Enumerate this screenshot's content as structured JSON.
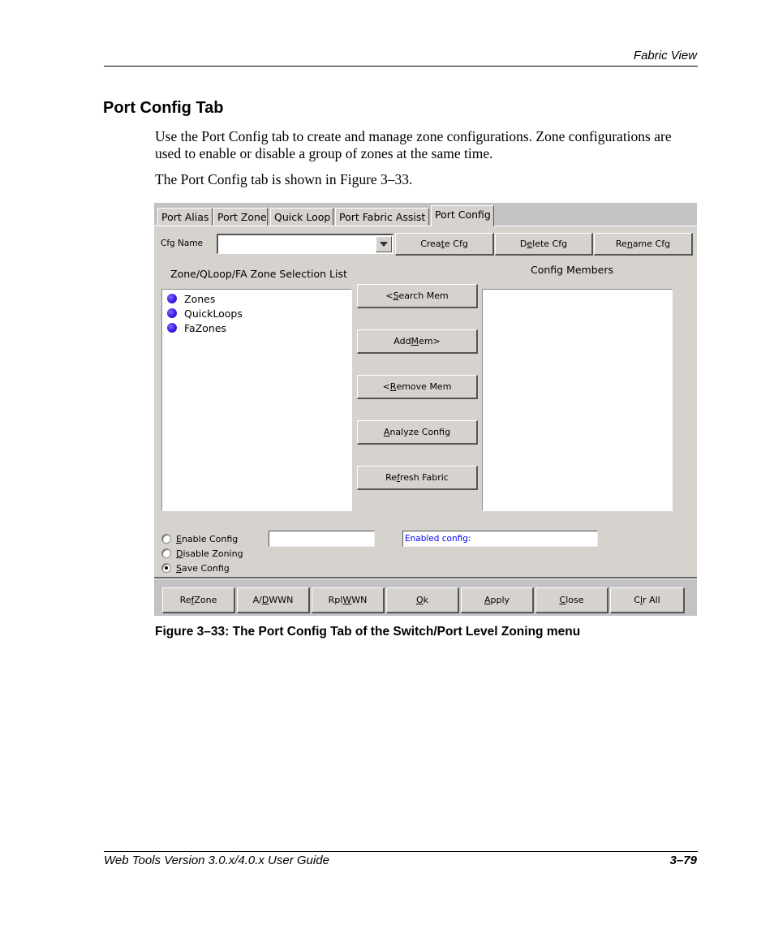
{
  "page_header": {
    "section": "Fabric View"
  },
  "section_title": "Port Config Tab",
  "paragraphs": [
    "Use the Port Config tab to create and manage zone configurations. Zone configurations are used to enable or disable a group of zones at the same time.",
    "The Port Config tab is shown in Figure 3–33."
  ],
  "ui": {
    "tabs": [
      {
        "label": "Port Alias",
        "active": false
      },
      {
        "label": "Port Zone",
        "active": false
      },
      {
        "label": "Quick Loop",
        "active": false
      },
      {
        "label": "Port Fabric Assist",
        "active": false
      },
      {
        "label": "Port Config",
        "active": true
      }
    ],
    "cfg_name": {
      "label": "Cfg Name",
      "value": ""
    },
    "top_buttons": {
      "create": {
        "pre": "Crea",
        "mn": "t",
        "post": "e Cfg"
      },
      "delete": {
        "pre": "D",
        "mn": "e",
        "post": "lete Cfg"
      },
      "rename": {
        "pre": "Re",
        "mn": "n",
        "post": "ame Cfg"
      }
    },
    "selection_list": {
      "title": "Zone/QLoop/FA Zone Selection List",
      "items": [
        "Zones",
        "QuickLoops",
        "FaZones"
      ],
      "icon": "blue-dot-icon",
      "icon_color": "#3a1de0"
    },
    "config_members": {
      "title": "Config Members",
      "items": []
    },
    "middle_buttons": {
      "search": {
        "pre": "<",
        "mn": "S",
        "post": "earch Mem"
      },
      "add": {
        "pre": "Add ",
        "mn": "M",
        "post": "em>"
      },
      "remove": {
        "pre": "<",
        "mn": "R",
        "post": "emove Mem"
      },
      "analyze": {
        "pre": "",
        "mn": "A",
        "post": "nalyze Config"
      },
      "refresh": {
        "pre": "Re",
        "mn": "f",
        "post": "resh Fabric"
      }
    },
    "radios": [
      {
        "mn": "E",
        "post": "nable Config",
        "checked": false
      },
      {
        "mn": "D",
        "post": "isable Zoning",
        "checked": false
      },
      {
        "mn": "S",
        "post": "ave Config",
        "checked": true
      }
    ],
    "enable_config_field": {
      "value": ""
    },
    "enabled_config_status": {
      "value": "Enabled config:",
      "color": "#0000ff"
    },
    "bottom_buttons": {
      "ref_zone": {
        "pre": "Re",
        "mn": "f",
        "post": " Zone"
      },
      "ad_wwn": {
        "pre": "A/",
        "mn": "D",
        "post": " WWN"
      },
      "rpl_wwn": {
        "pre": "Rpl ",
        "mn": "W",
        "post": "WN"
      },
      "ok": {
        "pre": "",
        "mn": "O",
        "post": "k"
      },
      "apply": {
        "pre": "",
        "mn": "A",
        "post": "pply"
      },
      "close": {
        "pre": "",
        "mn": "C",
        "post": "lose"
      },
      "clr_all": {
        "pre": "C",
        "mn": "l",
        "post": "r All"
      }
    }
  },
  "figure_caption": "Figure 3–33:  The Port Config Tab of the Switch/Port Level Zoning menu",
  "page_footer": {
    "title": "Web Tools Version 3.0.x/4.0.x User Guide",
    "page_number": "3–79"
  }
}
